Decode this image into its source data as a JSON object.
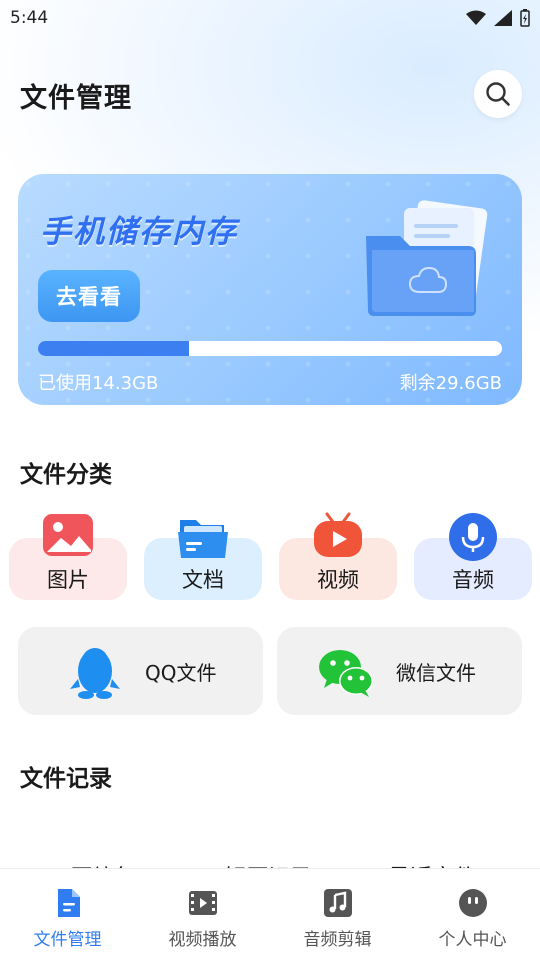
{
  "status_bar": {
    "time": "5:44"
  },
  "header": {
    "title": "文件管理"
  },
  "storage": {
    "heading": "手机储存内存",
    "button_label": "去看看",
    "used_label": "已使用14.3GB",
    "remaining_label": "剩余29.6GB",
    "used_fraction": 0.326
  },
  "categories": {
    "title": "文件分类",
    "items": [
      {
        "label": "图片",
        "icon": "image-icon"
      },
      {
        "label": "文档",
        "icon": "folder-icon"
      },
      {
        "label": "视频",
        "icon": "video-icon"
      },
      {
        "label": "音频",
        "icon": "microphone-icon"
      }
    ]
  },
  "apps": [
    {
      "label": "QQ文件",
      "icon": "qq-penguin-icon"
    },
    {
      "label": "微信文件",
      "icon": "wechat-icon"
    }
  ],
  "records": {
    "title": "文件记录",
    "tabs": [
      "压缩包",
      "解压记录",
      "最近文件"
    ]
  },
  "tabbar": {
    "items": [
      {
        "label": "文件管理",
        "icon": "document-icon",
        "active": true
      },
      {
        "label": "视频播放",
        "icon": "film-icon",
        "active": false
      },
      {
        "label": "音频剪辑",
        "icon": "music-note-icon",
        "active": false
      },
      {
        "label": "个人中心",
        "icon": "face-icon",
        "active": false
      }
    ]
  },
  "colors": {
    "accent": "#2f7df0",
    "card_gradient_start": "#b9dbff",
    "card_gradient_end": "#7fb9ff",
    "progress_fill": "#3b7ff0"
  }
}
